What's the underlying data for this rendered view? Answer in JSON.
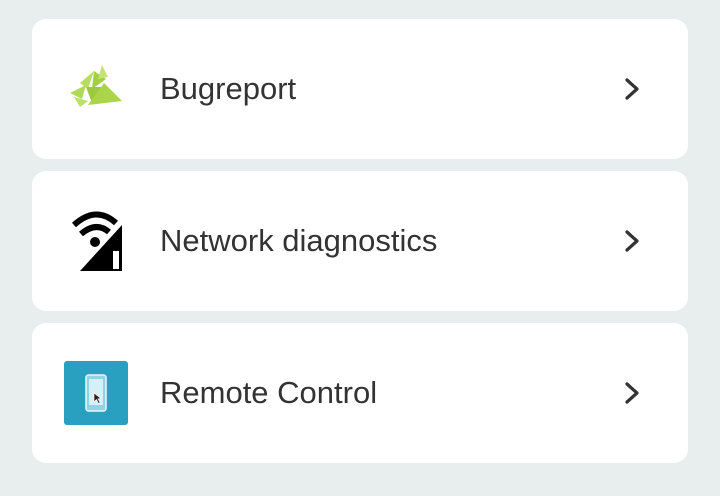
{
  "items": [
    {
      "label": "Bugreport",
      "icon": "bug-report-icon",
      "icon_color": "#a9d34a"
    },
    {
      "label": "Network diagnostics",
      "icon": "network-signal-icon",
      "icon_color": "#000000"
    },
    {
      "label": "Remote Control",
      "icon": "remote-control-icon",
      "icon_color": "#2aa0c0"
    }
  ],
  "colors": {
    "background": "#e8eeee",
    "card": "#ffffff",
    "text": "#333333",
    "chevron": "#333333"
  }
}
